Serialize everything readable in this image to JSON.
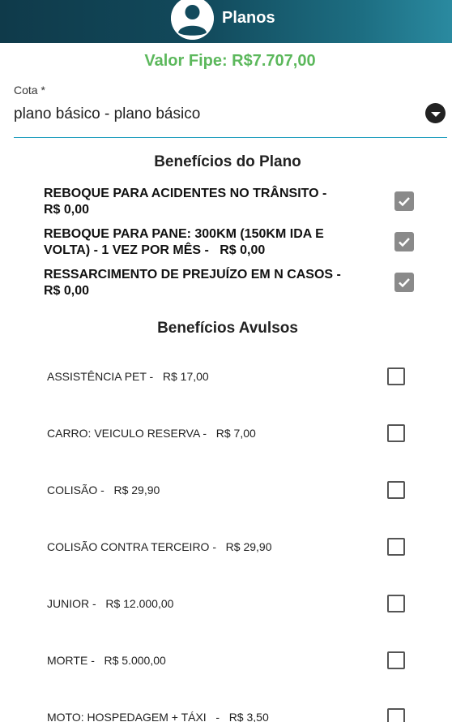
{
  "header": {
    "title": "Planos",
    "avatar_icon": "account-circle-icon",
    "gradient": [
      "#0f3a4a",
      "#2a8aa0"
    ]
  },
  "fipe": {
    "text": "Valor Fipe: R$7.707,00",
    "color": "#5cb85c"
  },
  "cota": {
    "label": "Cota *",
    "value": "plano básico - plano básico",
    "accent": "#26a0c0"
  },
  "plan_benefits": {
    "title": "Benefícios do Plano",
    "items": [
      {
        "line1": "REBOQUE PARA ACIDENTES NO TRÂNSITO -",
        "line2": "R$ 0,00",
        "checked": true
      },
      {
        "line1": "REBOQUE PARA PANE: 300KM (150KM IDA E",
        "line2": "VOLTA) - 1 VEZ POR MÊS -   R$ 0,00",
        "checked": true
      },
      {
        "line1": "RESSARCIMENTO DE PREJUÍZO EM N CASOS -",
        "line2": "R$ 0,00",
        "checked": true
      }
    ]
  },
  "avulsos": {
    "title": "Benefícios Avulsos",
    "items": [
      {
        "label": "ASSISTÊNCIA PET -   R$ 17,00",
        "checked": false
      },
      {
        "label": "CARRO: VEICULO RESERVA -   R$ 7,00",
        "checked": false
      },
      {
        "label": "COLISÃO -   R$ 29,90",
        "checked": false
      },
      {
        "label": "COLISÃO CONTRA TERCEIRO -   R$ 29,90",
        "checked": false
      },
      {
        "label": "JUNIOR -   R$ 12.000,00",
        "checked": false
      },
      {
        "label": "MORTE -   R$ 5.000,00",
        "checked": false
      },
      {
        "label": "MOTO: HOSPEDAGEM + TÁXI   -   R$ 3,50",
        "checked": false
      }
    ]
  }
}
